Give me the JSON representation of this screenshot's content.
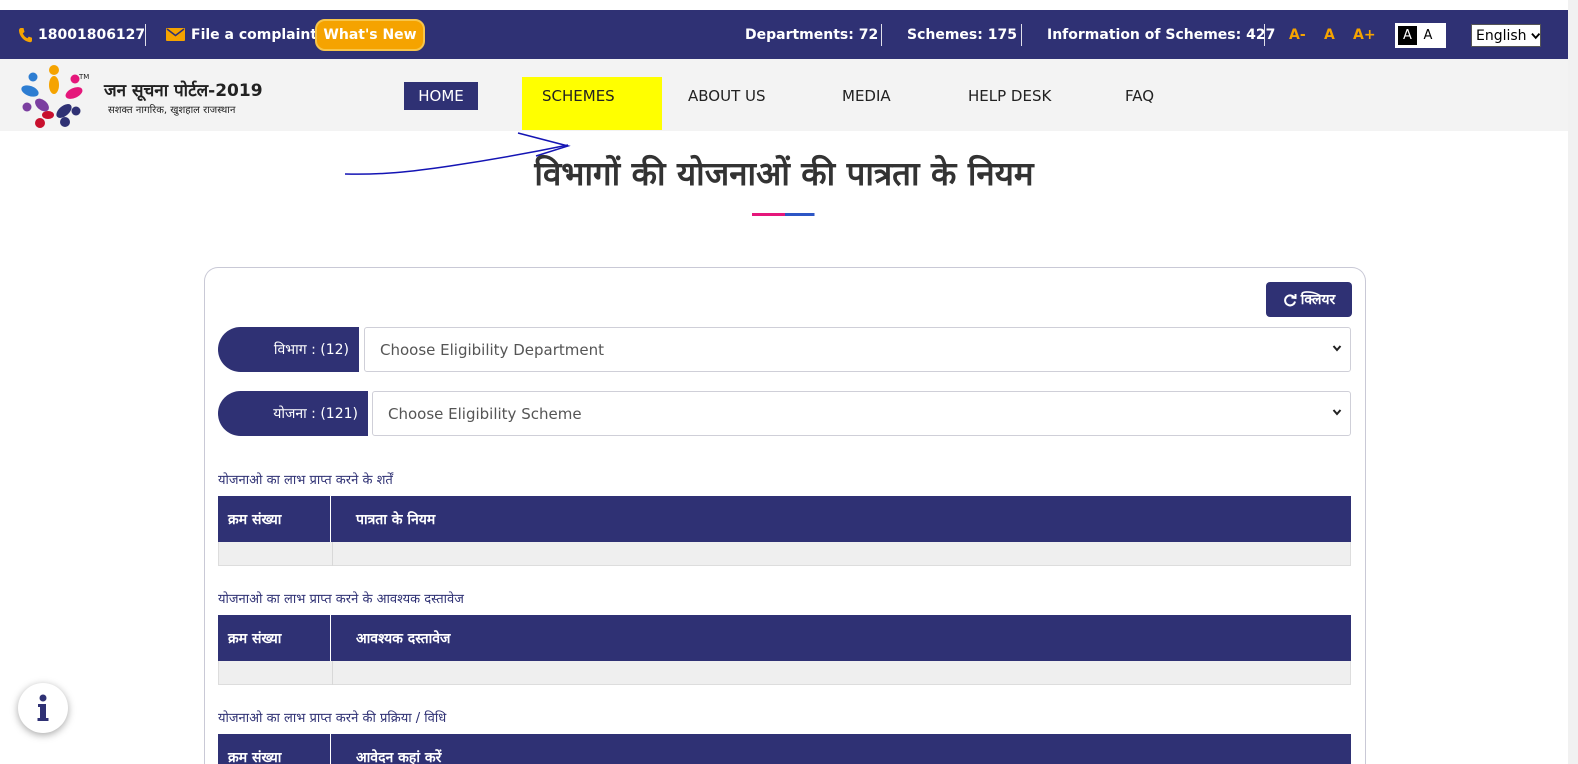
{
  "topbar": {
    "phone": "18001806127",
    "complaint": "File a complaint",
    "whats_new": "What's New",
    "departments": "Departments: 72",
    "schemes": "Schemes: 175",
    "info_schemes": "Information of Schemes: 427",
    "font_decrease": "A-",
    "font_normal": "A",
    "font_increase": "A+",
    "contrast_dark": "A",
    "contrast_light": "A",
    "language": "English",
    "icons": {
      "phone": "phone-icon",
      "mail": "mail-icon"
    },
    "colors": {
      "bar": "#2f3174",
      "accent": "#f5a300"
    }
  },
  "header": {
    "logo_title": "जन सूचना पोर्टल-2019",
    "logo_subtitle": "सशक्त नागरिक, खुशहाल राजस्थान",
    "logo_tm": "TM",
    "nav": {
      "home": "HOME",
      "schemes": "SCHEMES",
      "about": "ABOUT US",
      "media": "MEDIA",
      "helpdesk": "HELP DESK",
      "faq": "FAQ"
    }
  },
  "main": {
    "title": "विभागों की योजनाओं की पात्रता के नियम",
    "clear_button": "क्लियर",
    "filters": {
      "department_label": "विभाग : (12)",
      "department_value": "Choose Eligibility Department",
      "scheme_label": "योजना : (121)",
      "scheme_value": "Choose Eligibility Scheme"
    },
    "sections": [
      {
        "caption": "योजनाओ का लाभ प्राप्त करने के शर्तें",
        "col1": "क्रम संख्या",
        "col2": "पात्रता के नियम"
      },
      {
        "caption": "योजनाओ का लाभ प्राप्त करने के आवश्यक दस्तावेज",
        "col1": "क्रम संख्या",
        "col2": "आवश्यक दस्तावेज"
      },
      {
        "caption": "योजनाओ का लाभ प्राप्त करने की प्रक्रिया / विधि",
        "col1": "क्रम संख्या",
        "col2": "आवेदन कहां करें"
      }
    ]
  }
}
